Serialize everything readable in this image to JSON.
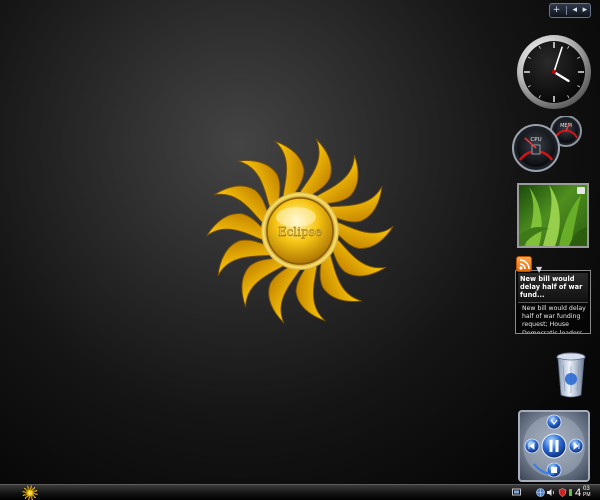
{
  "desktop": {
    "logo_text": "Eclipse"
  },
  "sidebar": {
    "controls": {
      "add_symbol": "+",
      "prev_symbol": "◂",
      "next_symbol": "▸"
    },
    "clock": {
      "hour": 4,
      "minute": 3
    },
    "meter": {
      "cpu_label": "CPU",
      "mem_label": "MEM",
      "cpu_percent": 30,
      "mem_percent": 60
    },
    "feed": {
      "headline": "New bill would delay half of war fund...",
      "body": "New bill would delay half of war funding request; House Democratic leaders are preparing a"
    }
  },
  "taskbar": {
    "clock": {
      "hour": "4",
      "minute": "03",
      "ampm": "PM"
    }
  },
  "colors": {
    "sun_gold": "#f5c10a",
    "sun_deep": "#c98a00",
    "feed_orange": "#f47a0a",
    "media_blue": "#2e6fd6"
  },
  "icons": [
    "start-orb-icon",
    "rss-icon",
    "recycle-bin-icon",
    "play-pause-icon",
    "previous-icon",
    "next-icon",
    "stop-icon",
    "network-icon",
    "volume-icon",
    "security-icon"
  ]
}
